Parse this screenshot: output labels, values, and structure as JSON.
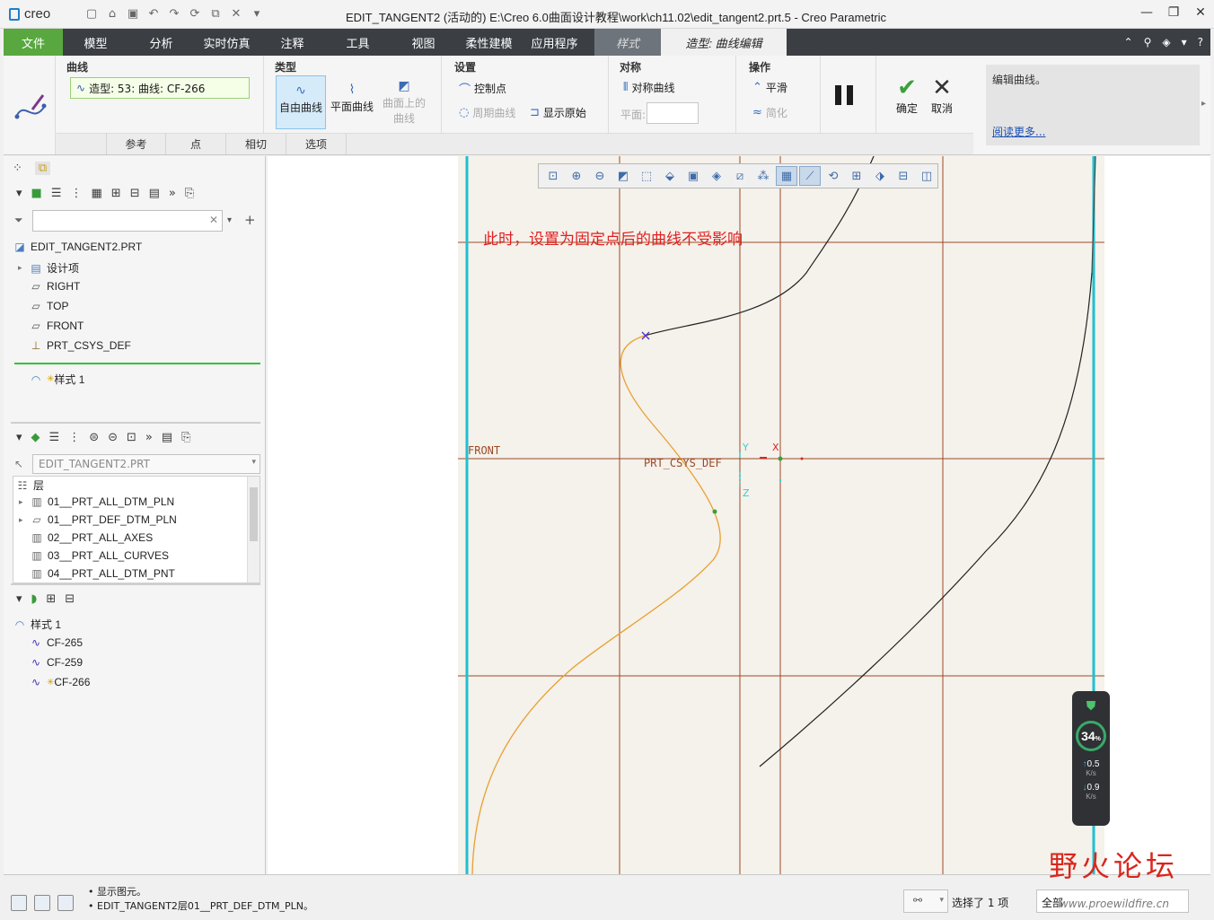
{
  "app": {
    "logo": "creo",
    "title": "EDIT_TANGENT2 (活动的) E:\\Creo 6.0曲面设计教程\\work\\ch11.02\\edit_tangent2.prt.5 - Creo Parametric"
  },
  "menu": {
    "items": [
      "文件",
      "模型",
      "分析",
      "实时仿真",
      "注释",
      "工具",
      "视图",
      "柔性建模",
      "应用程序"
    ],
    "style_tab": "样式",
    "active_tab": "造型: 曲线编辑"
  },
  "ribbon": {
    "curve": {
      "title": "曲线",
      "field": "造型: 53: 曲线: CF-266"
    },
    "type": {
      "title": "类型",
      "free": "自由曲线",
      "planar": "平面曲线",
      "surface": "曲面上的\n曲线"
    },
    "settings": {
      "title": "设置",
      "control_points": "控制点",
      "periodic": "周期曲线",
      "show_original": "显示原始"
    },
    "symmetry": {
      "title": "对称",
      "symmetric_curve": "对称曲线",
      "plane_label": "平面:"
    },
    "operation": {
      "title": "操作",
      "smooth": "平滑",
      "simplify": "简化"
    },
    "ok": "确定",
    "cancel": "取消",
    "info_text": "编辑曲线。",
    "info_link": "阅读更多...",
    "subtabs": [
      "参考",
      "点",
      "相切",
      "选项"
    ]
  },
  "model_tree": {
    "root": "EDIT_TANGENT2.PRT",
    "items": [
      "设计项",
      "RIGHT",
      "TOP",
      "FRONT",
      "PRT_CSYS_DEF"
    ],
    "inserted": "样式 1"
  },
  "layers": {
    "combo": "EDIT_TANGENT2.PRT",
    "header": "层",
    "items": [
      "01__PRT_ALL_DTM_PLN",
      "01__PRT_DEF_DTM_PLN",
      "02__PRT_ALL_AXES",
      "03__PRT_ALL_CURVES",
      "04__PRT_ALL_DTM_PNT"
    ]
  },
  "style_tree": {
    "root": "样式 1",
    "items": [
      "CF-265",
      "CF-259",
      "CF-266"
    ]
  },
  "graphics": {
    "annotation": "此时，设置为固定点后的曲线不受影响",
    "front_label": "FRONT",
    "csys_label": "PRT_CSYS_DEF",
    "axis_x": "X",
    "axis_y": "Y",
    "axis_z": "Z",
    "speed": {
      "percent": "34",
      "unit": "%",
      "up": "0.5",
      "down": "0.9",
      "rate_unit": "K/s"
    }
  },
  "status": {
    "messages": [
      "显示图元。",
      "EDIT_TANGENT2层01__PRT_DEF_DTM_PLN。"
    ],
    "selection": "选择了 1 项",
    "filter": "全部"
  },
  "watermark": {
    "text": "野火论坛",
    "url": "www.proewildfire.cn"
  },
  "colors": {
    "accent_green": "#58a83f",
    "menubar": "#3b3f44",
    "orange_curve": "#e8a030",
    "datum": "#9a4a24",
    "annotation": "#e02020"
  }
}
